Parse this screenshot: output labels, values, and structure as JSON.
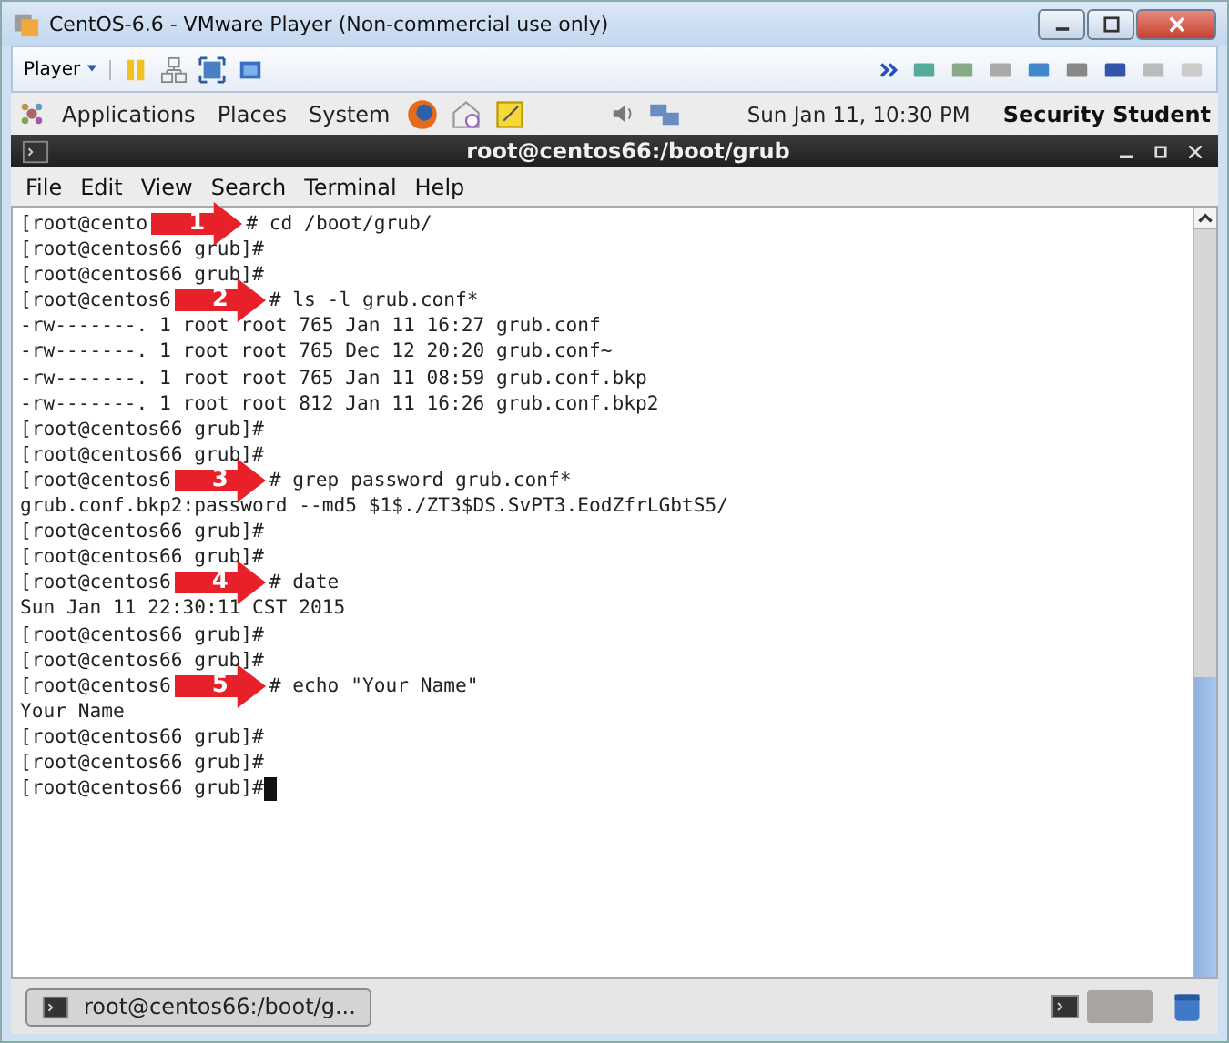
{
  "window": {
    "title": "CentOS-6.6 - VMware Player (Non-commercial use only)"
  },
  "player_toolbar": {
    "menu_label": "Player"
  },
  "gnome_panel": {
    "menus": [
      "Applications",
      "Places",
      "System"
    ],
    "clock": "Sun Jan 11, 10:30 PM",
    "user": "Security Student"
  },
  "terminal": {
    "title": "root@centos66:/boot/grub",
    "menu": [
      "File",
      "Edit",
      "View",
      "Search",
      "Terminal",
      "Help"
    ],
    "lines": [
      {
        "kind": "step",
        "prefix": "[root@cento",
        "step": "1",
        "command": "# cd /boot/grub/"
      },
      {
        "kind": "plain",
        "text": "[root@centos66 grub]#"
      },
      {
        "kind": "plain",
        "text": "[root@centos66 grub]#"
      },
      {
        "kind": "step",
        "prefix": "[root@centos6",
        "step": "2",
        "command": "# ls -l grub.conf*"
      },
      {
        "kind": "plain",
        "text": "-rw-------. 1 root root 765 Jan 11 16:27 grub.conf"
      },
      {
        "kind": "plain",
        "text": "-rw-------. 1 root root 765 Dec 12 20:20 grub.conf~"
      },
      {
        "kind": "plain",
        "text": "-rw-------. 1 root root 765 Jan 11 08:59 grub.conf.bkp"
      },
      {
        "kind": "plain",
        "text": "-rw-------. 1 root root 812 Jan 11 16:26 grub.conf.bkp2"
      },
      {
        "kind": "plain",
        "text": "[root@centos66 grub]#"
      },
      {
        "kind": "plain",
        "text": "[root@centos66 grub]#"
      },
      {
        "kind": "step",
        "prefix": "[root@centos6",
        "step": "3",
        "command": "# grep password grub.conf*"
      },
      {
        "kind": "plain",
        "text": "grub.conf.bkp2:password --md5 $1$./ZT3$DS.SvPT3.EodZfrLGbtS5/"
      },
      {
        "kind": "plain",
        "text": "[root@centos66 grub]#"
      },
      {
        "kind": "plain",
        "text": "[root@centos66 grub]#"
      },
      {
        "kind": "step",
        "prefix": "[root@centos6",
        "step": "4",
        "command": "# date"
      },
      {
        "kind": "plain",
        "text": "Sun Jan 11 22:30:11 CST 2015"
      },
      {
        "kind": "plain",
        "text": "[root@centos66 grub]#"
      },
      {
        "kind": "plain",
        "text": "[root@centos66 grub]#"
      },
      {
        "kind": "step",
        "prefix": "[root@centos6",
        "step": "5",
        "command": "# echo \"Your Name\""
      },
      {
        "kind": "plain",
        "text": "Your Name"
      },
      {
        "kind": "plain",
        "text": "[root@centos66 grub]#"
      },
      {
        "kind": "plain",
        "text": "[root@centos66 grub]#"
      },
      {
        "kind": "cursor",
        "text": "[root@centos66 grub]#"
      }
    ]
  },
  "taskbar": {
    "items": [
      {
        "label": "root@centos66:/boot/g...",
        "selected": true
      }
    ]
  }
}
